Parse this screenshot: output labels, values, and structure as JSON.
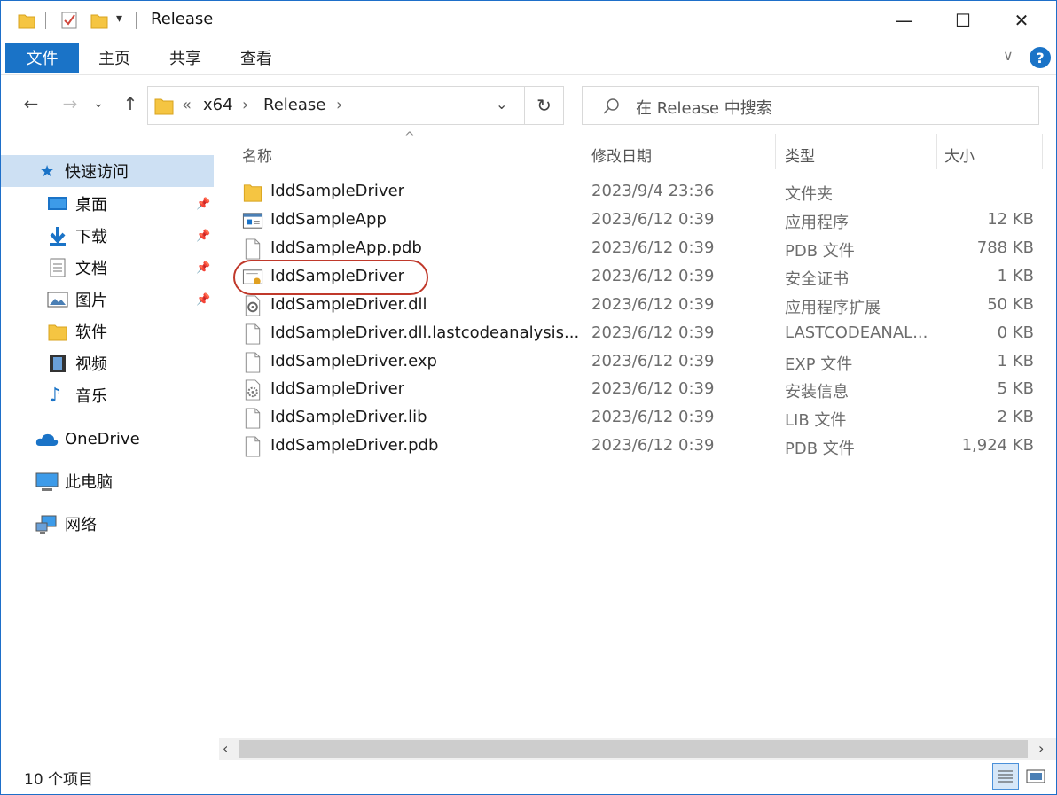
{
  "window": {
    "title": "Release",
    "minimize": "—",
    "maximize": "☐",
    "close": "✕"
  },
  "ribbon": {
    "tabs": [
      "文件",
      "主页",
      "共享",
      "查看"
    ],
    "collapse_glyph": "∨",
    "help_glyph": "?"
  },
  "address": {
    "overflow": "«",
    "parts": [
      "x64",
      "Release"
    ],
    "separator": "›"
  },
  "search": {
    "placeholder": "在 Release 中搜索"
  },
  "sidebar": {
    "quick_access": "快速访问",
    "items": [
      {
        "label": "桌面",
        "icon": "desktop-icon",
        "pinned": true
      },
      {
        "label": "下载",
        "icon": "download-icon",
        "pinned": true
      },
      {
        "label": "文档",
        "icon": "documents-icon",
        "pinned": true
      },
      {
        "label": "图片",
        "icon": "pictures-icon",
        "pinned": true
      },
      {
        "label": "软件",
        "icon": "folder-icon",
        "pinned": false
      },
      {
        "label": "视频",
        "icon": "video-icon",
        "pinned": false
      },
      {
        "label": "音乐",
        "icon": "music-icon",
        "pinned": false
      }
    ],
    "onedrive": "OneDrive",
    "this_pc": "此电脑",
    "network": "网络"
  },
  "columns": {
    "name": "名称",
    "date": "修改日期",
    "type": "类型",
    "size": "大小",
    "sort_glyph": "^"
  },
  "files": [
    {
      "name": "IddSampleDriver",
      "date": "2023/9/4 23:36",
      "type": "文件夹",
      "size": "",
      "icon": "folder-icon"
    },
    {
      "name": "IddSampleApp",
      "date": "2023/6/12 0:39",
      "type": "应用程序",
      "size": "12 KB",
      "icon": "application-icon"
    },
    {
      "name": "IddSampleApp.pdb",
      "date": "2023/6/12 0:39",
      "type": "PDB 文件",
      "size": "788 KB",
      "icon": "file-icon"
    },
    {
      "name": "IddSampleDriver",
      "date": "2023/6/12 0:39",
      "type": "安全证书",
      "size": "1 KB",
      "icon": "certificate-icon"
    },
    {
      "name": "IddSampleDriver.dll",
      "date": "2023/6/12 0:39",
      "type": "应用程序扩展",
      "size": "50 KB",
      "icon": "dll-icon"
    },
    {
      "name": "IddSampleDriver.dll.lastcodeanalysis...",
      "date": "2023/6/12 0:39",
      "type": "LASTCODEANAL...",
      "size": "0 KB",
      "icon": "file-icon"
    },
    {
      "name": "IddSampleDriver.exp",
      "date": "2023/6/12 0:39",
      "type": "EXP 文件",
      "size": "1 KB",
      "icon": "file-icon"
    },
    {
      "name": "IddSampleDriver",
      "date": "2023/6/12 0:39",
      "type": "安装信息",
      "size": "5 KB",
      "icon": "setup-info-icon"
    },
    {
      "name": "IddSampleDriver.lib",
      "date": "2023/6/12 0:39",
      "type": "LIB 文件",
      "size": "2 KB",
      "icon": "file-icon"
    },
    {
      "name": "IddSampleDriver.pdb",
      "date": "2023/6/12 0:39",
      "type": "PDB 文件",
      "size": "1,924 KB",
      "icon": "file-icon"
    }
  ],
  "highlighted_row": 3,
  "status": {
    "count": "10 个项目"
  },
  "colors": {
    "accent": "#1a73c7",
    "highlight_ring": "#c0392b",
    "folder": "#f5c542"
  }
}
